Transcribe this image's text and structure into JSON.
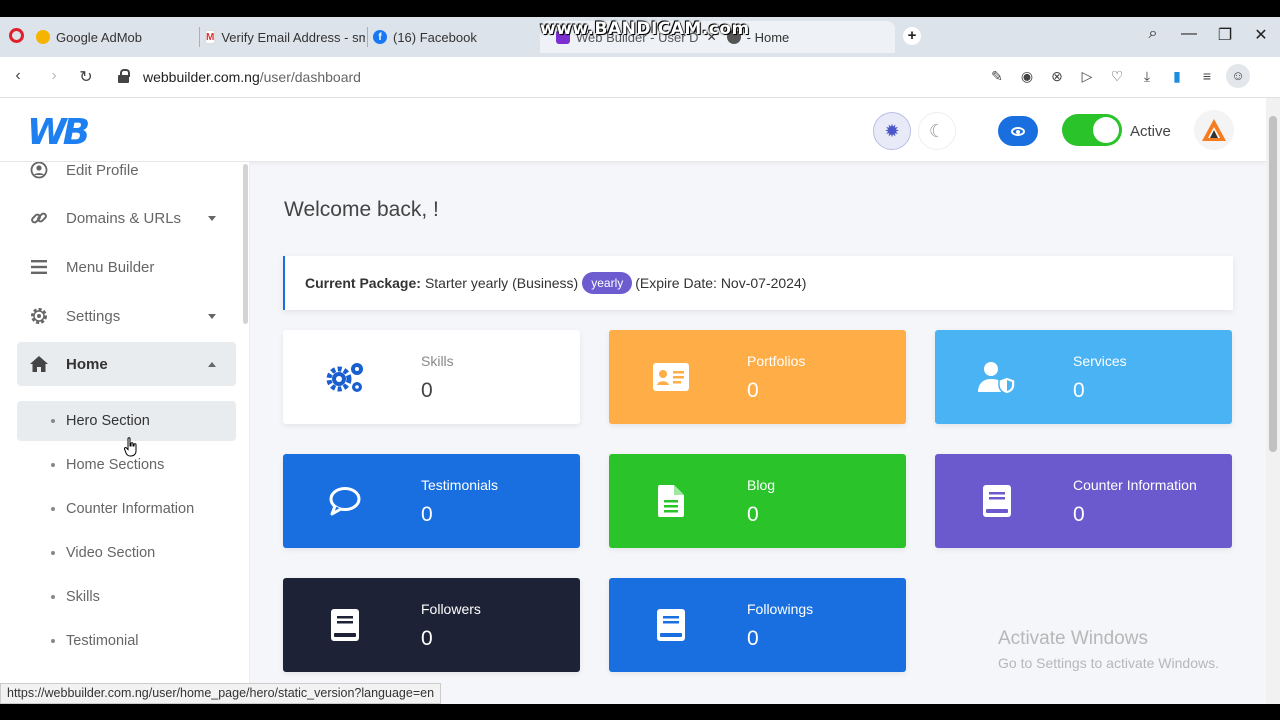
{
  "overlay": {
    "watermark": "www.BANDICAM.com"
  },
  "browser": {
    "tabs": [
      {
        "title": "Google AdMob",
        "icon": "admob-icon"
      },
      {
        "title": "Verify Email Address - smt",
        "icon": "gmail-icon"
      },
      {
        "title": "(16) Facebook",
        "icon": "facebook-icon"
      },
      {
        "title": "Web Builder - User D",
        "icon": "webbuilder-icon"
      },
      {
        "title": "- Home",
        "icon": "page-icon"
      }
    ],
    "url_host": "webbuilder.com.ng",
    "url_path": "/user/dashboard",
    "status_url": "https://webbuilder.com.ng/user/home_page/hero/static_version?language=en"
  },
  "header": {
    "logo": "WB",
    "status_label": "Active",
    "toggle_on": true
  },
  "sidebar": {
    "items": [
      {
        "label": "Edit Profile",
        "icon": "user-circle-icon"
      },
      {
        "label": "Domains & URLs",
        "icon": "link-icon"
      },
      {
        "label": "Menu Builder",
        "icon": "bars-icon"
      },
      {
        "label": "Settings",
        "icon": "gear-icon"
      },
      {
        "label": "Home",
        "icon": "home-icon"
      }
    ],
    "subitems": [
      {
        "label": "Hero Section"
      },
      {
        "label": "Home Sections"
      },
      {
        "label": "Counter Information"
      },
      {
        "label": "Video Section"
      },
      {
        "label": "Skills"
      },
      {
        "label": "Testimonial"
      }
    ]
  },
  "main": {
    "welcome": "Welcome back, !",
    "package": {
      "label": "Current Package:",
      "name": "Starter yearly (Business)",
      "badge": "yearly",
      "expire": "(Expire Date: Nov-07-2024)"
    },
    "cards": [
      {
        "title": "Skills",
        "value": "0",
        "color": "#ffffff",
        "icon": "gears-icon"
      },
      {
        "title": "Portfolios",
        "value": "0",
        "color": "#ffad46",
        "icon": "id-card-icon"
      },
      {
        "title": "Services",
        "value": "0",
        "color": "#4ab3f4",
        "icon": "user-shield-icon"
      },
      {
        "title": "Testimonials",
        "value": "0",
        "color": "#1a6fe0",
        "icon": "comment-icon"
      },
      {
        "title": "Blog",
        "value": "0",
        "color": "#2ac42a",
        "icon": "file-icon"
      },
      {
        "title": "Counter Information",
        "value": "0",
        "color": "#6a5acd",
        "icon": "book-icon"
      },
      {
        "title": "Followers",
        "value": "0",
        "color": "#1d2236",
        "icon": "book-icon"
      },
      {
        "title": "Followings",
        "value": "0",
        "color": "#1a6fe0",
        "icon": "book-icon"
      }
    ]
  },
  "os": {
    "activate_title": "Activate Windows",
    "activate_sub": "Go to Settings to activate Windows."
  }
}
